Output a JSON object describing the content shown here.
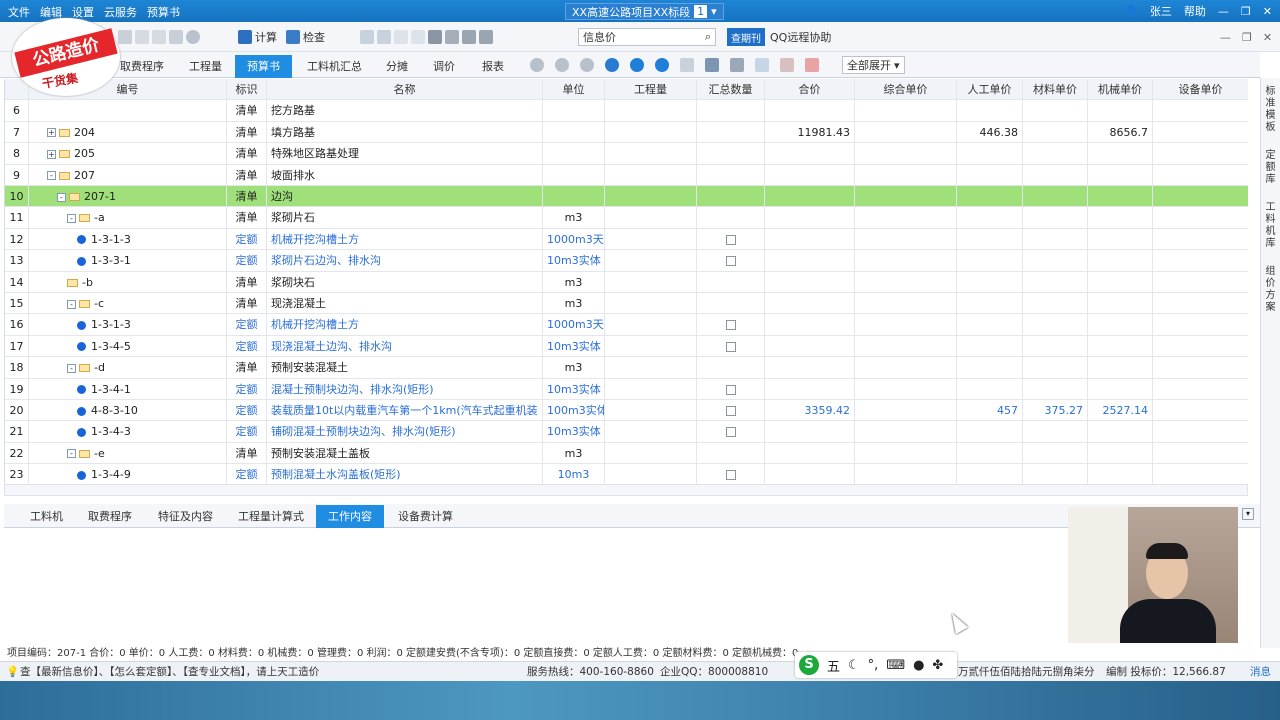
{
  "titlebar": {
    "menu": [
      "文件",
      "编辑",
      "设置",
      "云服务",
      "预算书"
    ],
    "project": "XX高速公路项目XX标段",
    "project_index": "1",
    "user": "张三",
    "help": "帮助"
  },
  "toolbar": {
    "calc": "计算",
    "check": "检查",
    "price_label": "信息价",
    "badge": "查期刊",
    "remote": "QQ远程协助"
  },
  "logo": {
    "title": "公路造价",
    "subtitle": "干货集"
  },
  "tabs": [
    "取费程序",
    "工程量",
    "预算书",
    "工料机汇总",
    "分摊",
    "调价",
    "报表"
  ],
  "active_tab": "预算书",
  "expand_all": "全部展开",
  "columns": [
    "",
    "编号",
    "标识",
    "名称",
    "单位",
    "工程量",
    "汇总数量",
    "合价",
    "综合单价",
    "人工单价",
    "材料单价",
    "机械单价",
    "设备单价"
  ],
  "rows": [
    {
      "n": "6",
      "code": "",
      "flag": "清单",
      "name": "挖方路基",
      "unit": "",
      "sum": "",
      "total": "",
      "labor": "",
      "mat": "",
      "mach": "",
      "kind": "list",
      "lvl": 0
    },
    {
      "n": "7",
      "code": "204",
      "flag": "清单",
      "name": "填方路基",
      "unit": "",
      "sum": "",
      "total": "11981.43",
      "labor": "446.38",
      "mat": "",
      "mach": "8656.7",
      "kind": "list",
      "lvl": 1,
      "exp": "+"
    },
    {
      "n": "8",
      "code": "205",
      "flag": "清单",
      "name": "特殊地区路基处理",
      "unit": "",
      "total": "",
      "labor": "",
      "mat": "",
      "mach": "",
      "kind": "list",
      "lvl": 1,
      "exp": "+"
    },
    {
      "n": "9",
      "code": "207",
      "flag": "清单",
      "name": "坡面排水",
      "unit": "",
      "total": "",
      "labor": "",
      "mat": "",
      "mach": "",
      "kind": "list",
      "lvl": 1,
      "exp": "-"
    },
    {
      "n": "10",
      "code": "207-1",
      "flag": "清单",
      "name": "边沟",
      "unit": "",
      "total": "",
      "labor": "",
      "mat": "",
      "mach": "",
      "kind": "list",
      "lvl": 2,
      "exp": "-",
      "sel": true
    },
    {
      "n": "11",
      "code": "-a",
      "flag": "清单",
      "name": "浆砌片石",
      "unit": "m3",
      "total": "",
      "kind": "list",
      "lvl": 3,
      "exp": "-"
    },
    {
      "n": "12",
      "code": "1-3-1-3",
      "flag": "定额",
      "name": "机械开挖沟槽土方",
      "unit": "1000m3天...",
      "chk": true,
      "kind": "quota",
      "lvl": 4
    },
    {
      "n": "13",
      "code": "1-3-3-1",
      "flag": "定额",
      "name": "浆砌片石边沟、排水沟",
      "unit": "10m3实体",
      "chk": true,
      "kind": "quota",
      "lvl": 4
    },
    {
      "n": "14",
      "code": "-b",
      "flag": "清单",
      "name": "浆砌块石",
      "unit": "m3",
      "kind": "list",
      "lvl": 3
    },
    {
      "n": "15",
      "code": "-c",
      "flag": "清单",
      "name": "现浇混凝土",
      "unit": "m3",
      "kind": "list",
      "lvl": 3,
      "exp": "-"
    },
    {
      "n": "16",
      "code": "1-3-1-3",
      "flag": "定额",
      "name": "机械开挖沟槽土方",
      "unit": "1000m3天...",
      "chk": true,
      "kind": "quota",
      "lvl": 4
    },
    {
      "n": "17",
      "code": "1-3-4-5",
      "flag": "定额",
      "name": "现浇混凝土边沟、排水沟",
      "unit": "10m3实体",
      "chk": true,
      "kind": "quota",
      "lvl": 4
    },
    {
      "n": "18",
      "code": "-d",
      "flag": "清单",
      "name": "预制安装混凝土",
      "unit": "m3",
      "kind": "list",
      "lvl": 3,
      "exp": "-"
    },
    {
      "n": "19",
      "code": "1-3-4-1",
      "flag": "定额",
      "name": "混凝土预制块边沟、排水沟(矩形)",
      "unit": "10m3实体",
      "chk": true,
      "kind": "quota",
      "lvl": 4
    },
    {
      "n": "20",
      "code": "4-8-3-10",
      "flag": "定额",
      "name": "装载质量10t以内载重汽车第一个1km(汽车式起重机装",
      "unit": "100m3实体",
      "chk": true,
      "total": "3359.42",
      "labor": "457",
      "mat": "375.27",
      "mach": "2527.14",
      "kind": "quota",
      "lvl": 4
    },
    {
      "n": "21",
      "code": "1-3-4-3",
      "flag": "定额",
      "name": "铺砌混凝土预制块边沟、排水沟(矩形)",
      "unit": "10m3实体",
      "chk": true,
      "kind": "quota",
      "lvl": 4
    },
    {
      "n": "22",
      "code": "-e",
      "flag": "清单",
      "name": "预制安装混凝土盖板",
      "unit": "m3",
      "kind": "list",
      "lvl": 3,
      "exp": "-"
    },
    {
      "n": "23",
      "code": "1-3-4-9",
      "flag": "定额",
      "name": "预制混凝土水沟盖板(矩形)",
      "unit": "10m3",
      "chk": true,
      "kind": "quota",
      "lvl": 4
    }
  ],
  "side_panel": [
    "标准模板",
    "定额库",
    "工料机库",
    "组价方案"
  ],
  "bottom_tabs": [
    "工料机",
    "取费程序",
    "特征及内容",
    "工程量计算式",
    "工作内容",
    "设备费计算"
  ],
  "bottom_active": "工作内容",
  "status_line": "项目编码：207-1  合价：0  单价：0  人工费：0  材料费：0  机械费：0  管理费：0  利润：0  定额建安费(不含专项)：0  定额直接费：0  定额人工费：0  定额材料费：0  定额机械费：0",
  "status2": {
    "tips": "查【最新信息价】、【怎么套定额】、【查专业文档】，请上天工造价",
    "hotline": "服务热线：400-160-8860",
    "qq": "企业QQ：800008810",
    "amount_words": "万贰仟伍佰陆拾陆元捌角柒分",
    "bid": "编制 投标价：12,566.87",
    "msg": "消息"
  },
  "ime": {
    "label": "五"
  }
}
